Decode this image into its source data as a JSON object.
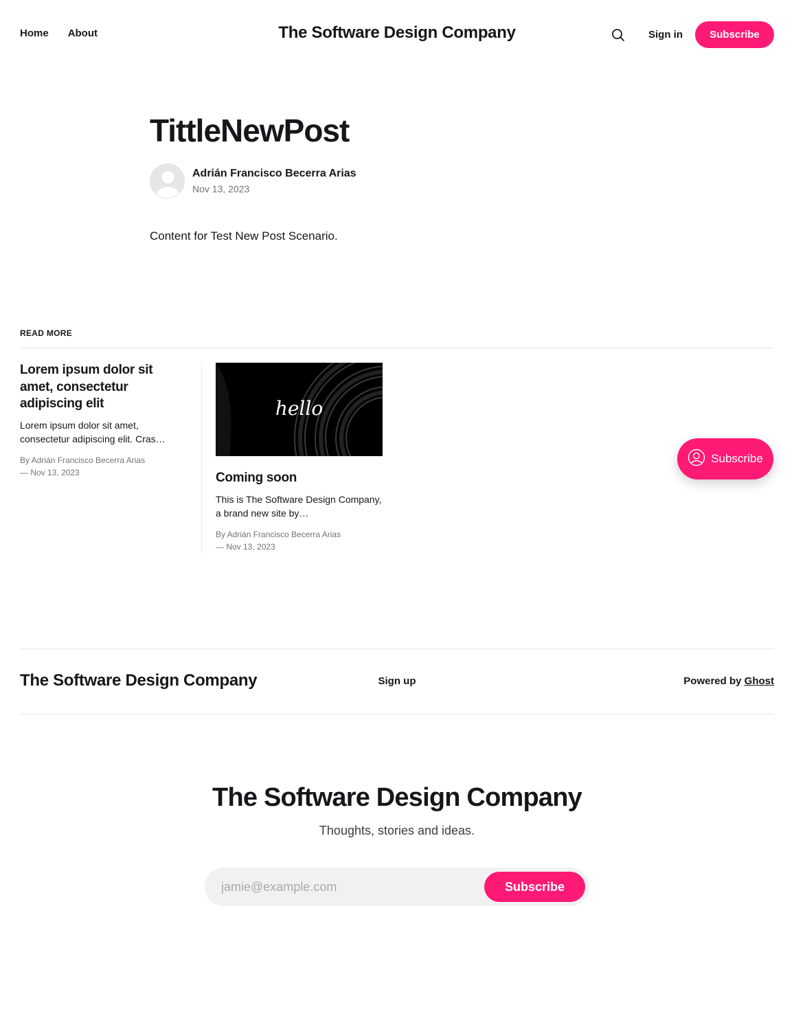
{
  "header": {
    "nav": [
      {
        "label": "Home"
      },
      {
        "label": "About"
      }
    ],
    "site_title": "The Software Design Company",
    "search_icon": "search-icon",
    "sign_in": "Sign in",
    "subscribe": "Subscribe"
  },
  "post": {
    "title": "TittleNewPost",
    "author": "Adrián Francisco Becerra Arias",
    "date": "Nov 13, 2023",
    "content": "Content for Test New Post Scenario."
  },
  "read_more": {
    "heading": "READ MORE",
    "cards": [
      {
        "title": "Lorem ipsum dolor sit amet, consectetur adipiscing elit",
        "excerpt": "Lorem ipsum dolor sit amet, consectetur adipiscing elit. Cras…",
        "author_line": "By Adrián Francisco Becerra Arias",
        "date_line": "— Nov 13, 2023"
      },
      {
        "image_text": "hello",
        "title": "Coming soon",
        "excerpt": "This is The Software Design Company, a brand new site by…",
        "author_line": "By Adrián Francisco Becerra Arias",
        "date_line": "— Nov 13, 2023"
      }
    ]
  },
  "floating_subscribe": {
    "label": "Subscribe",
    "icon": "user-circle-icon"
  },
  "footer": {
    "site_title": "The Software Design Company",
    "sign_up": "Sign up",
    "powered_prefix": "Powered by",
    "powered_link": "Ghost"
  },
  "cta": {
    "title": "The Software Design Company",
    "subtitle": "Thoughts, stories and ideas.",
    "email_placeholder": "jamie@example.com",
    "button": "Subscribe"
  },
  "colors": {
    "accent": "#ff1a75",
    "text": "#15171a",
    "muted": "#6f7377"
  }
}
